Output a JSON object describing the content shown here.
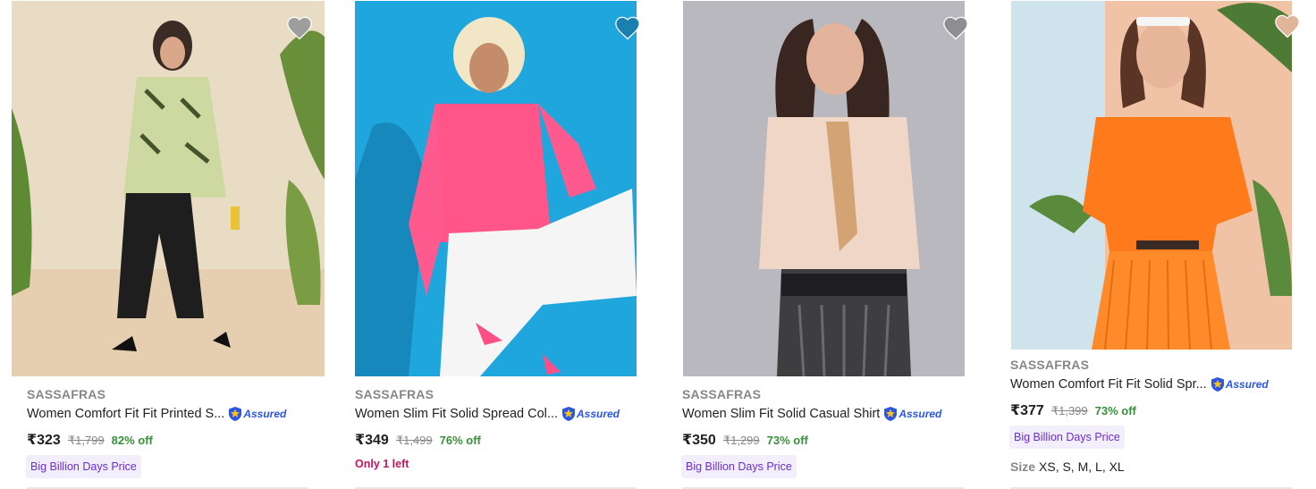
{
  "assured_label": "Assured",
  "colors": {
    "price_green": "#388e3c",
    "assured_blue": "#2a55e5",
    "badge_bg": "#f3eefc",
    "badge_text": "#6a2ed0",
    "stock_text": "#c1175f"
  },
  "products": [
    {
      "brand": "SASSAFRAS",
      "title": "Women Comfort Fit Fit Printed S...",
      "price": "₹323",
      "mrp": "₹1,799",
      "discount": "82% off",
      "badge": "Big Billion Days Price",
      "icon": "heart-icon"
    },
    {
      "brand": "SASSAFRAS",
      "title": "Women Slim Fit Solid Spread Col...",
      "price": "₹349",
      "mrp": "₹1,499",
      "discount": "76% off",
      "stock_note": "Only 1 left",
      "icon": "heart-icon"
    },
    {
      "brand": "SASSAFRAS",
      "title": "Women Slim Fit Solid Casual Shirt",
      "price": "₹350",
      "mrp": "₹1,299",
      "discount": "73% off",
      "badge": "Big Billion Days Price",
      "icon": "heart-icon"
    },
    {
      "brand": "SASSAFRAS",
      "title": "Women Comfort Fit Fit Solid Spr...",
      "price": "₹377",
      "mrp": "₹1,399",
      "discount": "73% off",
      "badge": "Big Billion Days Price",
      "size_label": "Size",
      "sizes": "XS, S, M, L, XL",
      "icon": "heart-icon"
    }
  ]
}
